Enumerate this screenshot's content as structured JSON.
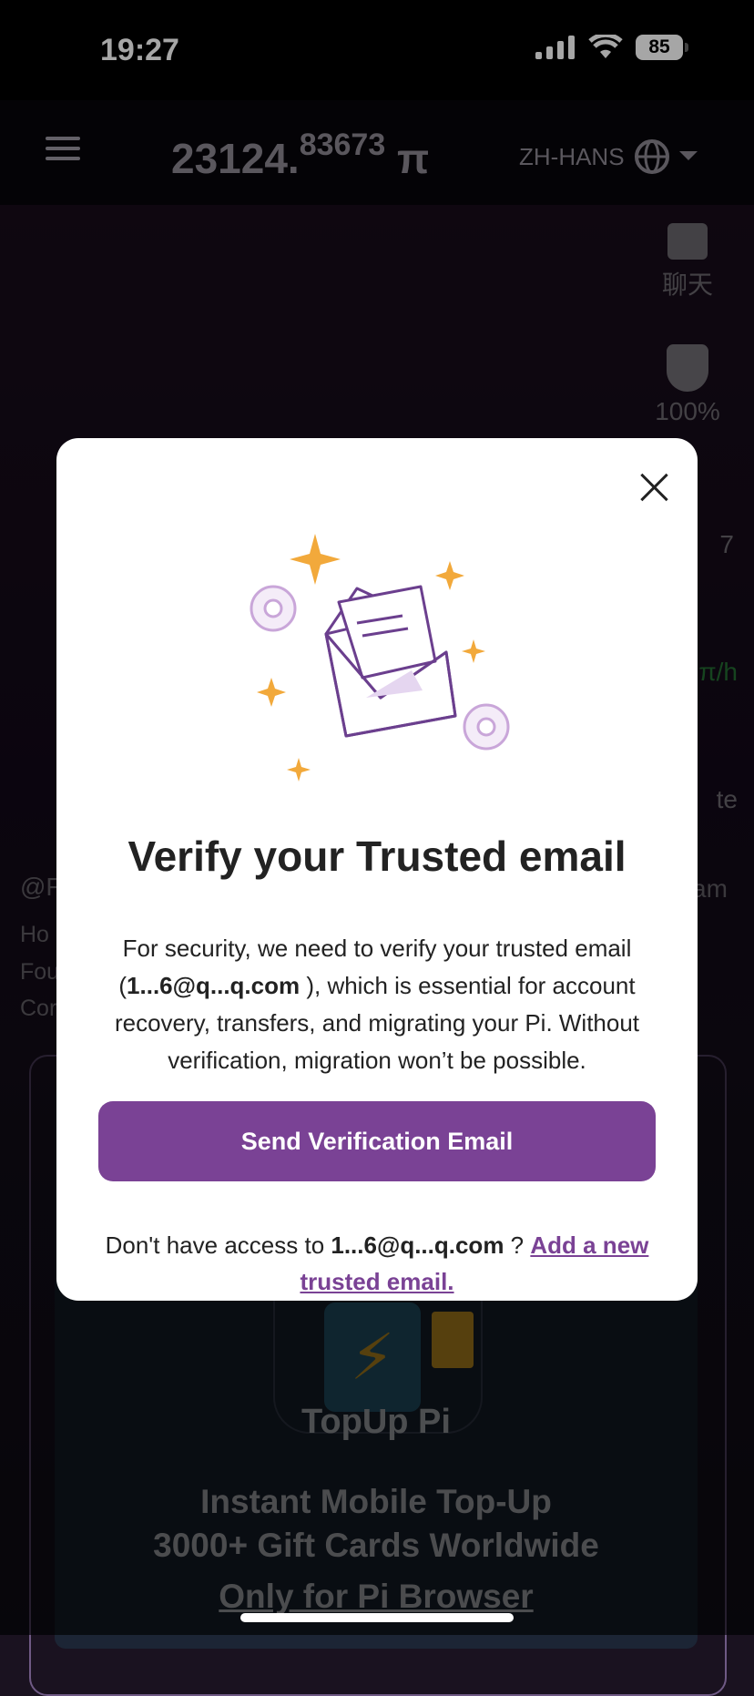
{
  "status_bar": {
    "time": "19:27",
    "battery": "85"
  },
  "header": {
    "balance_int": "23124.",
    "balance_dec": "83673",
    "currency": "π",
    "language": "ZH-HANS"
  },
  "side_menu": {
    "chat_label": "聊天",
    "security_label": "100%",
    "users_partial": "7",
    "rate_partial": "π/h",
    "invite_partial": "te"
  },
  "profile": {
    "handle_partial": "@F",
    "line1": "Ho",
    "line2": "Fou",
    "line3": "Cor",
    "right_partial": "am"
  },
  "promo": {
    "label": "TopUp Pi",
    "line1": "Instant Mobile Top-Up",
    "line2": "3000+ Gift Cards Worldwide",
    "line3": "Only for Pi Browser"
  },
  "modal": {
    "title": "Verify your Trusted email",
    "desc_pre": "For security, we need to verify your trusted email (",
    "email": "1...6@q...q.com",
    "desc_post": " ), which is essential for account recovery, transfers, and migrating your Pi. Without verification, migration won’t be possible.",
    "button": "Send Verification Email",
    "access_pre": "Don't have access to ",
    "access_post": " ? ",
    "add_link": "Add a new trusted email."
  },
  "colors": {
    "accent": "#7a4295",
    "star": "#f2a93b"
  }
}
